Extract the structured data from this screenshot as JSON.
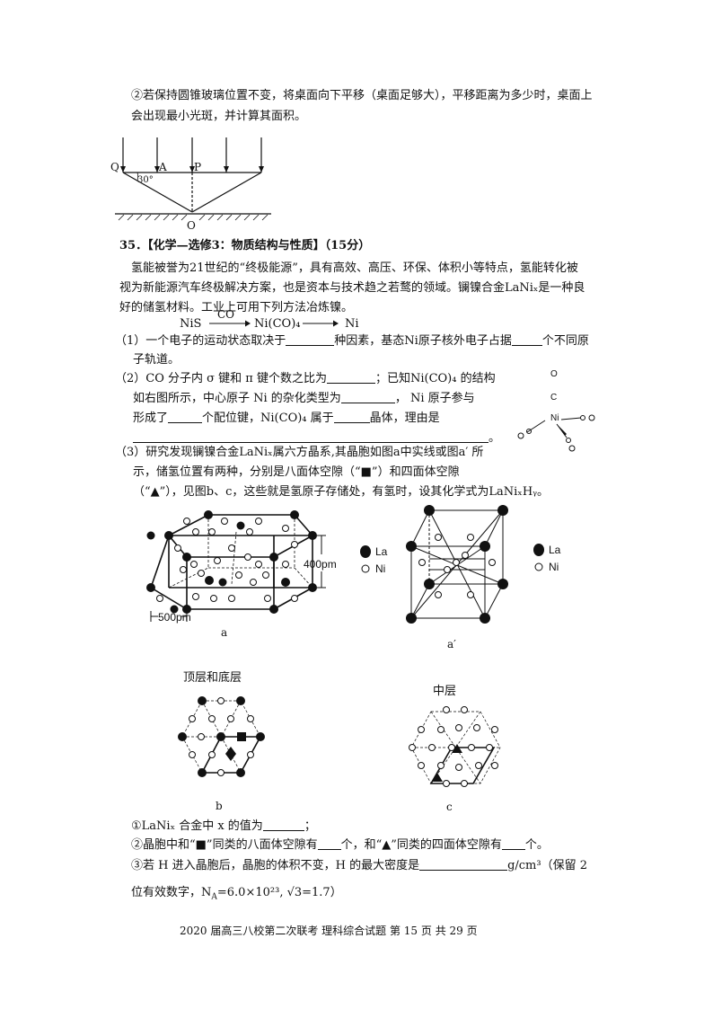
{
  "q_top": {
    "line1": "②若保持圆锥玻璃位置不变，将桌面向下平移（桌面足够大），平移距离为多少时，桌面上",
    "line2": "会出现最小光斑，并计算其面积。"
  },
  "optics_fig": {
    "Q": "Q",
    "A": "A",
    "P": "P",
    "O": "O",
    "angle": "30°"
  },
  "q35": {
    "header_num": "35．",
    "header": "【化学—选修3：物质结构与性质】（15分）",
    "intro1": "氢能被誉为21世纪的“终极能源”，具有高效、高压、环保、体积小等特点，氢能转化被",
    "intro2": "视为新能源汽车终极解决方案，也是资本与技术趋之若鹜的领域。镧镍合金LaNiₓ是一种良",
    "intro3": "好的储氢材料。工业上可用下列方法冶炼镍。",
    "reaction": {
      "a": "NiS",
      "over": "CO",
      "b": "Ni(CO)₄",
      "c": "Ni"
    },
    "p1_a": "（1）一个电子的运动状态取决于",
    "p1_b": "种因素，基态Ni原子核外电子占据",
    "p1_c": "个不同原",
    "p1_d": "子轨道。",
    "p2_a": "（2）CO 分子内 σ 键和 π 键个数之比为",
    "p2_b": "；已知Ni(CO)₄ 的结构",
    "p2_c": "如右图所示，中心原子 Ni 的杂化类型为",
    "p2_d": "，  Ni 原子参与",
    "p2_e": "形成了",
    "p2_f": "个配位键，Ni(CO)₄ 属于",
    "p2_g": "晶体，理由是",
    "p2_end": "。",
    "p3_a": "（3）研究发现镧镍合金LaNiₓ属六方晶系,其晶胞如图a中实线或图a′ 所",
    "p3_b": "示，储氢位置有两种，分别是八面体空隙（“■”）和四面体空隙",
    "p3_c": "（“▲”），见图b、c，这些就是氢原子存储处，有氢时，设其化学式为LaNiₓHᵧ。",
    "q_i": "①LaNiₓ 合金中 x 的值为",
    "q_i_end": "；",
    "q_ii_a": "②晶胞中和“■”同类的八面体空隙有",
    "q_ii_b": "个，和“▲”同类的四面体空隙有",
    "q_ii_c": "个。",
    "q_iii_a": "③若 H 进入晶胞后，晶胞的体积不变，H 的最大密度是",
    "q_iii_b": "g/cm³（保留 2",
    "q_iii_c": "位有效数字，N",
    "q_iii_d": "A",
    "q_iii_e": "=6.0×10²³, √3=1.7）"
  },
  "nico": {
    "O1": "O",
    "C1": "C",
    "Ni": "Ni"
  },
  "fig_a": {
    "label": "a",
    "dim_h": "400pm",
    "dim_w": "500pm"
  },
  "fig_a2": {
    "label": "a′"
  },
  "legend": {
    "La": "La",
    "Ni": "Ni"
  },
  "fig_b": {
    "title": "顶层和底层",
    "label": "b"
  },
  "fig_c": {
    "title": "中层",
    "label": "c"
  },
  "footer": {
    "text": "2020 届高三八校第二次联考    理科综合试题    第 15 页  共 29 页"
  }
}
